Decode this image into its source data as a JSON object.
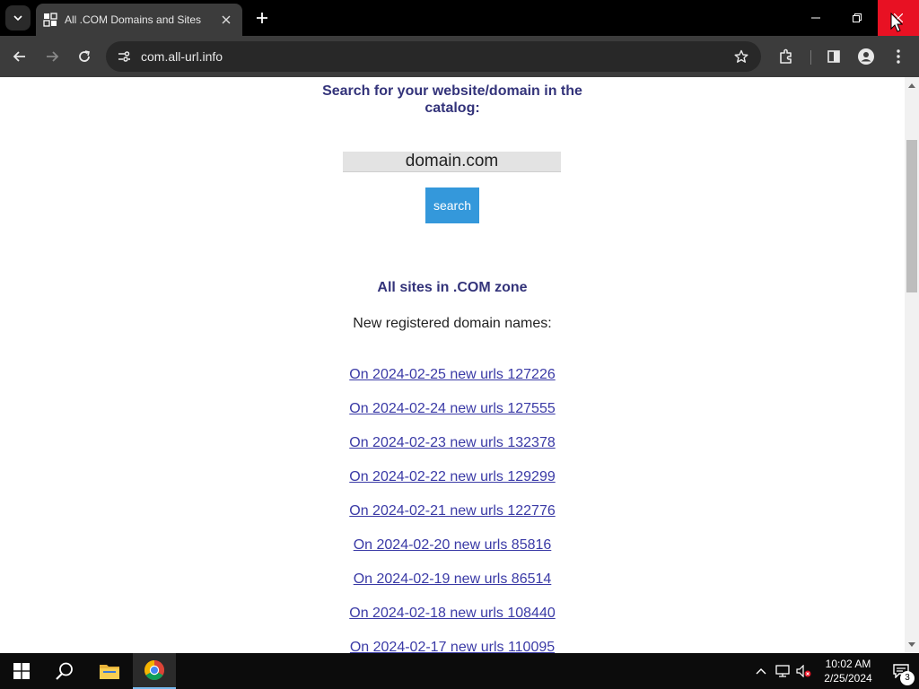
{
  "browser": {
    "tab_title": "All .COM Domains and Sites",
    "url": "com.all-url.info"
  },
  "page": {
    "search_heading": "Search for your website/domain in the catalog:",
    "search_value": "domain.com",
    "search_button": "search",
    "zone_heading": "All sites in .COM zone",
    "new_domains_label": "New registered domain names:",
    "links": [
      "On 2024-02-25 new urls 127226",
      "On 2024-02-24 new urls 127555",
      "On 2024-02-23 new urls 132378",
      "On 2024-02-22 new urls 129299",
      "On 2024-02-21 new urls 122776",
      "On 2024-02-20 new urls 85816",
      "On 2024-02-19 new urls 86514",
      "On 2024-02-18 new urls 108440",
      "On 2024-02-17 new urls 110095"
    ]
  },
  "taskbar": {
    "time": "10:02 AM",
    "date": "2/25/2024",
    "notification_count": "3"
  },
  "colors": {
    "heading": "#33337a",
    "link": "#3a3aa6",
    "button": "#3498db",
    "close_button": "#e81123"
  },
  "icons": [
    "tab-search-icon",
    "favicon-icon",
    "close-icon",
    "plus-icon",
    "minimize-icon",
    "restore-icon",
    "back-icon",
    "forward-icon",
    "reload-icon",
    "site-info-icon",
    "star-icon",
    "extensions-icon",
    "side-panel-icon",
    "profile-icon",
    "menu-icon",
    "windows-start-icon",
    "search-icon",
    "file-explorer-icon",
    "chrome-icon",
    "chevron-up-icon",
    "network-icon",
    "volume-muted-icon",
    "notification-icon"
  ]
}
